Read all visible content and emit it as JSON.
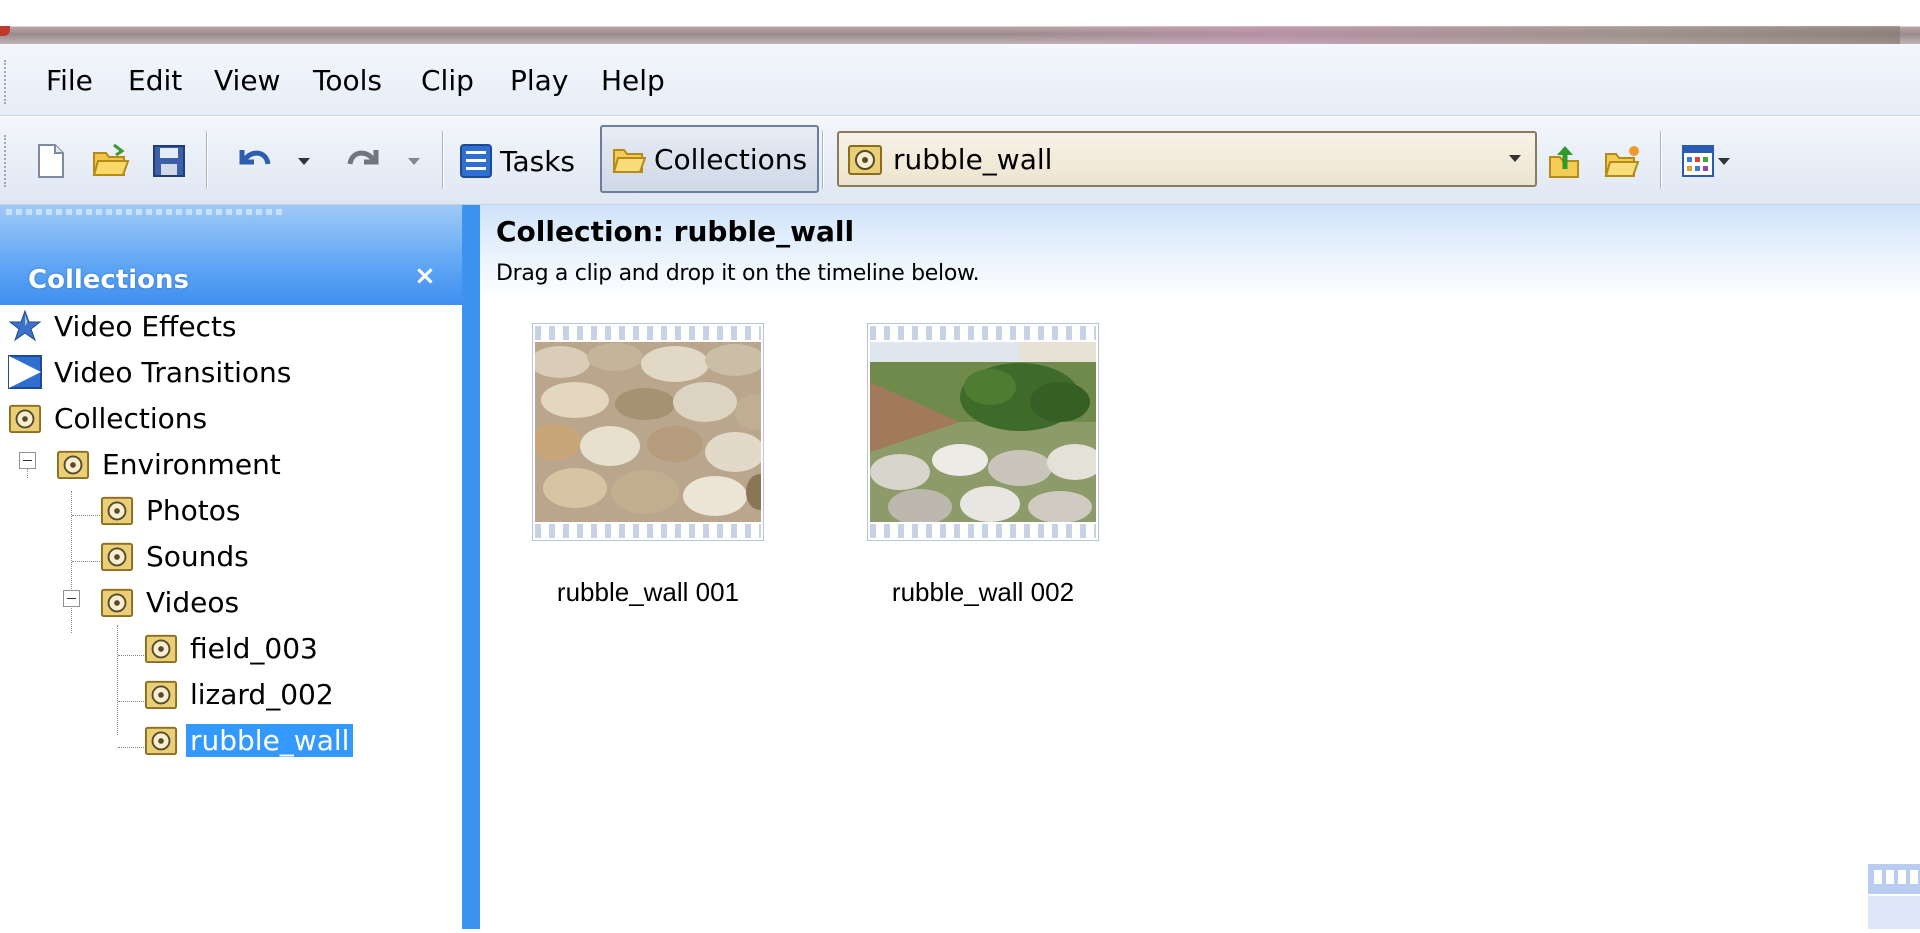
{
  "menu": {
    "file": "File",
    "edit": "Edit",
    "view": "View",
    "tools": "Tools",
    "clip": "Clip",
    "play": "Play",
    "help": "Help"
  },
  "toolbar": {
    "tasks_label": "Tasks",
    "collections_label": "Collections",
    "collection_selector_value": "rubble_wall"
  },
  "left_pane": {
    "title": "Collections",
    "close_glyph": "×",
    "tree": [
      {
        "label": "Video Effects",
        "icon": "star-icon"
      },
      {
        "label": "Video Transitions",
        "icon": "transition-icon"
      },
      {
        "label": "Collections",
        "icon": "collection-folder-icon"
      },
      {
        "label": "Environment",
        "icon": "collection-folder-icon"
      },
      {
        "label": "Photos",
        "icon": "collection-folder-icon"
      },
      {
        "label": "Sounds",
        "icon": "collection-folder-icon"
      },
      {
        "label": "Videos",
        "icon": "collection-folder-icon"
      },
      {
        "label": "field_003",
        "icon": "collection-folder-icon"
      },
      {
        "label": "lizard_002",
        "icon": "collection-folder-icon"
      },
      {
        "label": "rubble_wall",
        "icon": "collection-folder-icon",
        "selected": true
      }
    ]
  },
  "content": {
    "title": "Collection: rubble_wall",
    "subtitle": "Drag a clip and drop it on the timeline below.",
    "clips": [
      {
        "label": "rubble_wall 001"
      },
      {
        "label": "rubble_wall 002"
      }
    ]
  },
  "colors": {
    "pane_header": "#3f8ff0",
    "selection": "#3399ff",
    "splitter": "#3d93f2"
  }
}
